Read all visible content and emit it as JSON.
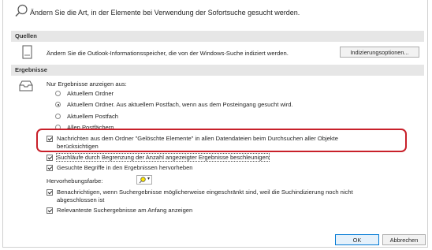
{
  "header": {
    "text": "Ändern Sie die Art, in der Elemente bei Verwendung der Sofortsuche gesucht werden."
  },
  "quellen": {
    "title": "Quellen",
    "description": "Ändern Sie die Outlook-Informationsspeicher, die von der Windows-Suche indiziert werden.",
    "indexing_button": "Indizierungsoptionen..."
  },
  "ergebnisse": {
    "title": "Ergebnisse",
    "only_results_label": "Nur Ergebnisse anzeigen aus:",
    "radios": [
      {
        "label": "Aktuellem Ordner",
        "selected": false
      },
      {
        "label": "Aktuellem Ordner. Aus aktuellem Postfach, wenn aus dem Posteingang gesucht wird.",
        "selected": true
      },
      {
        "label": "Aktuellem Postfach",
        "selected": false
      },
      {
        "label": "Allen Postfächern",
        "selected": false
      }
    ],
    "deleted_items_line1": "Nachrichten aus dem Ordner \"Gelöschte Elemente\" in allen Datendateien beim Durchsuchen aller Objekte",
    "deleted_items_line2": "berücksichtigen",
    "deleted_items_checked": true,
    "speed_up": "Suchläufe durch Begrenzung der Anzahl angezeigter Ergebnisse beschleunigen",
    "speed_up_checked": true,
    "highlight_terms": "Gesuchte Begriffe in den Ergebnissen hervorheben",
    "highlight_terms_checked": true,
    "highlight_color_label": "Hervorhebungsfarbe:",
    "notify_line1": "Benachrichtigen, wenn Suchergebnisse möglicherweise eingeschränkt sind, weil die Suchindizierung noch nicht",
    "notify_line2": "abgeschlossen ist",
    "notify_checked": true,
    "relevant_first": "Relevanteste Suchergebnisse am Anfang anzeigen",
    "relevant_first_checked": true
  },
  "footer": {
    "ok": "OK",
    "cancel": "Abbrechen"
  },
  "colors": {
    "highlight_box": "#c8202a",
    "section_bg": "#e6e6e6",
    "ok_border": "#0078d4"
  }
}
